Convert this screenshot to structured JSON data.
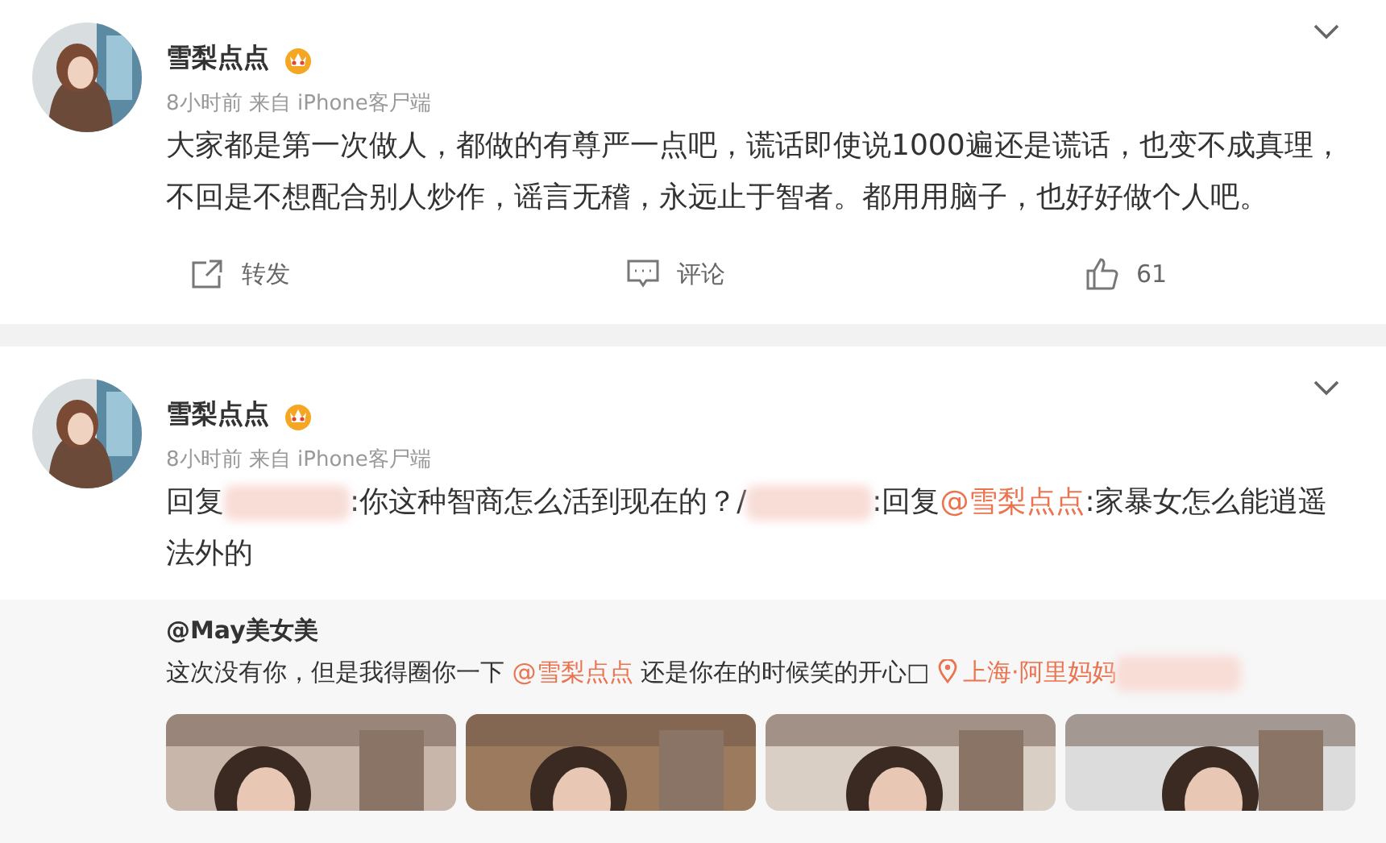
{
  "posts": [
    {
      "author": "雪梨点点",
      "meta": "8小时前 来自 iPhone客尸端",
      "body": [
        {
          "kind": "text",
          "text": "大家都是第一次做人，都做的有尊严一点吧，谎话即使说1000遍还是谎话，也变不成真理，不回是不想配合别人炒作，谣言无稽，永远止于智者。都用用脑子，也好好做个人吧。"
        }
      ],
      "actions": [
        {
          "kind": "repost",
          "label": "转发"
        },
        {
          "kind": "comment",
          "label": "评论"
        },
        {
          "kind": "like",
          "label": "61"
        }
      ]
    },
    {
      "author": "雪梨点点",
      "meta": "8小时前 来自 iPhone客尸端",
      "body": [
        {
          "kind": "text",
          "text": "回复"
        },
        {
          "kind": "redacted"
        },
        {
          "kind": "text",
          "text": ":你这种智商怎么活到现在的？/"
        },
        {
          "kind": "redacted"
        },
        {
          "kind": "text",
          "text": ":回复"
        },
        {
          "kind": "mention",
          "text": "@雪梨点点"
        },
        {
          "kind": "text",
          "text": ":家暴女怎么能逍遥法外的"
        }
      ],
      "quote": {
        "author": "@May美女美",
        "body": [
          {
            "kind": "text",
            "text": "这次没有你，但是我得圈你一下 "
          },
          {
            "kind": "mention",
            "text": "@雪梨点点"
          },
          {
            "kind": "text",
            "text": " 还是你在的时候笑的开心□ "
          },
          {
            "kind": "location",
            "text": "上海·阿里妈妈"
          },
          {
            "kind": "redacted"
          }
        ]
      }
    }
  ]
}
